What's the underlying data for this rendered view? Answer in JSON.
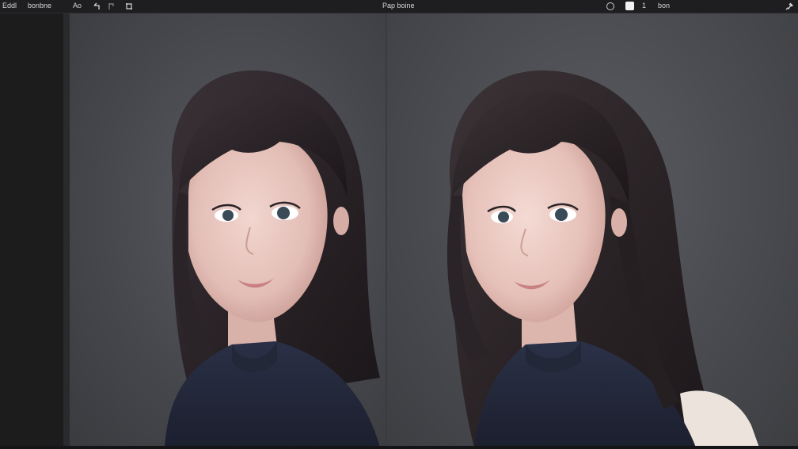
{
  "topbar": {
    "app_label": "Eddl",
    "menu_label": "bonbne",
    "tool_label": "Ao",
    "title": "Pap boine",
    "count_label": "1",
    "right_label": "bon"
  },
  "icons": {
    "undo": "undo-icon",
    "redo": "redo-icon",
    "crop": "crop-icon",
    "info": "info-circle-icon",
    "square": "square-icon",
    "pin": "pin-icon"
  },
  "colors": {
    "canvas_bg": "#46474b",
    "topbar_bg": "#1e1e20",
    "sidebar_bg": "#1c1c1d"
  }
}
